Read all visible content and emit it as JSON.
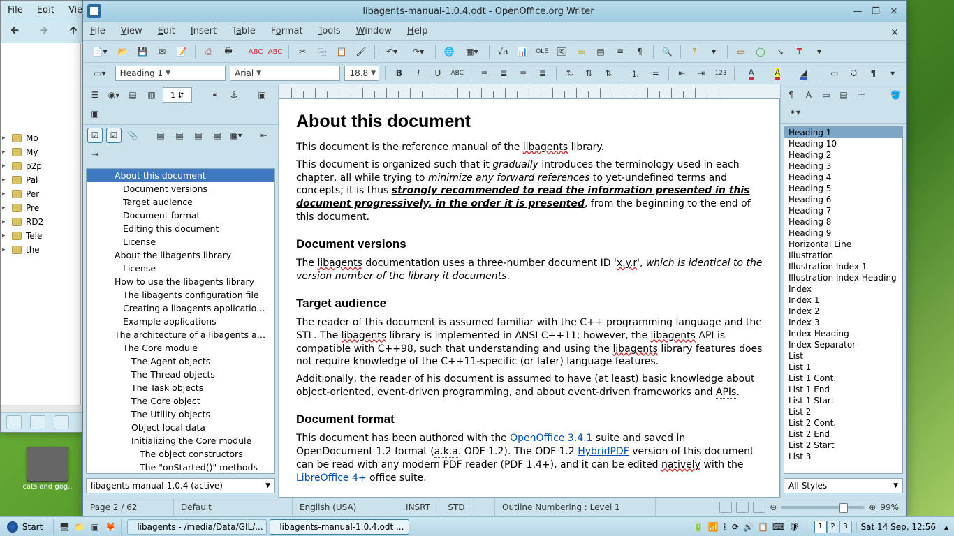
{
  "fm": {
    "menu": [
      "File",
      "Edit",
      "View"
    ],
    "tree": [
      {
        "label": "Mo",
        "pad": 1
      },
      {
        "label": "My",
        "pad": 1
      },
      {
        "label": "p2p",
        "pad": 1
      },
      {
        "label": "Pal",
        "pad": 1
      },
      {
        "label": "Per",
        "pad": 1
      },
      {
        "label": "Pre",
        "pad": 1
      },
      {
        "label": "RD2",
        "pad": 1
      },
      {
        "label": "Tele",
        "pad": 1
      },
      {
        "label": "the",
        "pad": 1
      }
    ]
  },
  "desktop_icon": "cats and gog..",
  "oo": {
    "title": "libagents-manual-1.0.4.odt - OpenOffice.org Writer",
    "menu": [
      "File",
      "View",
      "Edit",
      "Insert",
      "Table",
      "Format",
      "Tools",
      "Window",
      "Help"
    ],
    "menu_accel": [
      "F",
      "V",
      "E",
      "I",
      "a",
      "o",
      "T",
      "W",
      "H"
    ],
    "style": "Heading 1",
    "font": "Arial",
    "size": "18.8",
    "nav_page": "1",
    "nav_doc": "libagents-manual-1.0.4 (active)",
    "outline": [
      {
        "label": "About this document",
        "lvl": 1,
        "sel": true
      },
      {
        "label": "Document versions",
        "lvl": 2
      },
      {
        "label": "Target audience",
        "lvl": 2
      },
      {
        "label": "Document format",
        "lvl": 2
      },
      {
        "label": "Editing this document",
        "lvl": 2
      },
      {
        "label": "License",
        "lvl": 2
      },
      {
        "label": "About the libagents library",
        "lvl": 1
      },
      {
        "label": "License",
        "lvl": 2
      },
      {
        "label": "How to use the libagents library",
        "lvl": 1
      },
      {
        "label": "The libagents configuration file",
        "lvl": 2
      },
      {
        "label": "Creating a libagents application project",
        "lvl": 2
      },
      {
        "label": "Example applications",
        "lvl": 2
      },
      {
        "label": "The architecture of a libagents application",
        "lvl": 1
      },
      {
        "label": "The Core module",
        "lvl": 2
      },
      {
        "label": "The Agent objects",
        "lvl": 3
      },
      {
        "label": "The Thread objects",
        "lvl": 3
      },
      {
        "label": "The Task objects",
        "lvl": 3
      },
      {
        "label": "The Core object",
        "lvl": 3
      },
      {
        "label": "The Utility objects",
        "lvl": 3
      },
      {
        "label": "Object local data",
        "lvl": 3
      },
      {
        "label": "Initializing the Core module",
        "lvl": 3
      },
      {
        "label": "The object constructors",
        "lvl": 4
      },
      {
        "label": "The \"onStarted()\" methods",
        "lvl": 4
      }
    ],
    "styles": [
      "Heading 1",
      "Heading 10",
      "Heading 2",
      "Heading 3",
      "Heading 4",
      "Heading 5",
      "Heading 6",
      "Heading 7",
      "Heading 8",
      "Heading 9",
      "Horizontal Line",
      "Illustration",
      "Illustration Index 1",
      "Illustration Index Heading",
      "Index",
      "Index 1",
      "Index 2",
      "Index 3",
      "Index Heading",
      "Index Separator",
      "List",
      "List 1",
      "List 1 Cont.",
      "List 1 End",
      "List 1 Start",
      "List 2",
      "List 2 Cont.",
      "List 2 End",
      "List 2 Start",
      "List 3"
    ],
    "styles_filter": "All Styles",
    "status": {
      "page": "Page 2 / 62",
      "style": "Default",
      "lang": "English (USA)",
      "insert": "INSRT",
      "sel": "STD",
      "outline": "Outline Numbering : Level 1",
      "zoom": "99%"
    },
    "doc": {
      "h1_about": "About this document",
      "p1_a": "This document is the reference manual of the ",
      "p1_lib": "libagents",
      "p1_b": " library.",
      "p2_a": "This document is organized such that it ",
      "p2_grad": "gradually",
      "p2_b": " introduces the terminology used in each chapter, all while trying to ",
      "p2_min": "minimize any forward references",
      "p2_c": " to yet-undefined terms and concepts; it is thus ",
      "p2_strong": "strongly recommended to read the information presented in this document progressively, in the order it is presented",
      "p2_d": ", from the beginning to the end of this document.",
      "h2_versions": "Document versions",
      "p3_a": "The ",
      "p3_b": " documentation uses a three-number document ID '",
      "p3_xyr": "x.y.r",
      "p3_c": "', ",
      "p3_em": "which is identical to the version number of the library it documents",
      "p3_d": ".",
      "h2_audience": "Target audience",
      "p4": "The reader of this document is assumed familiar with the C++ programming language and the STL. The ",
      "p4b": " library is implemented in ANSI C++11; however, the ",
      "p4c": " API is compatible with C++98, such that understanding and using the ",
      "p4d": " library features does not require knowledge of the C++11-specific (or later) language features.",
      "p5_a": "Additionally, the reader of his document is assumed to have (at least) basic knowledge about object-oriented, event-driven programming, and about event-driven frameworks and ",
      "p5_api": "APIs",
      "p5_b": ".",
      "h2_format": "Document format",
      "p6_a": "This document has been authored with the ",
      "p6_link1": "OpenOffice 3.4.1",
      "p6_b": " suite and saved in OpenDocument 1.2 format (",
      "p6_aka": "a.k.a",
      "p6_c": ". ODF 1.2). The ODF 1.2 ",
      "p6_link2": "HybridPDF",
      "p6_d": " version of this document can be read with any modern PDF reader (PDF 1.4+), and it can be edited ",
      "p6_nat": "natively",
      "p6_e": " with the ",
      "p6_link3": "LibreOffice 4+",
      "p6_f": " office suite."
    }
  },
  "taskbar": {
    "start": "Start",
    "tasks": [
      {
        "label": "libagents - /media/Data/GIL/...",
        "active": false,
        "color": "#d8c36a"
      },
      {
        "label": "libagents-manual-1.0.4.odt ...",
        "active": true,
        "color": "#2a6aa3"
      }
    ],
    "vd": [
      "1",
      "2",
      "3"
    ],
    "clock": "Sat 14 Sep, 12:56"
  }
}
